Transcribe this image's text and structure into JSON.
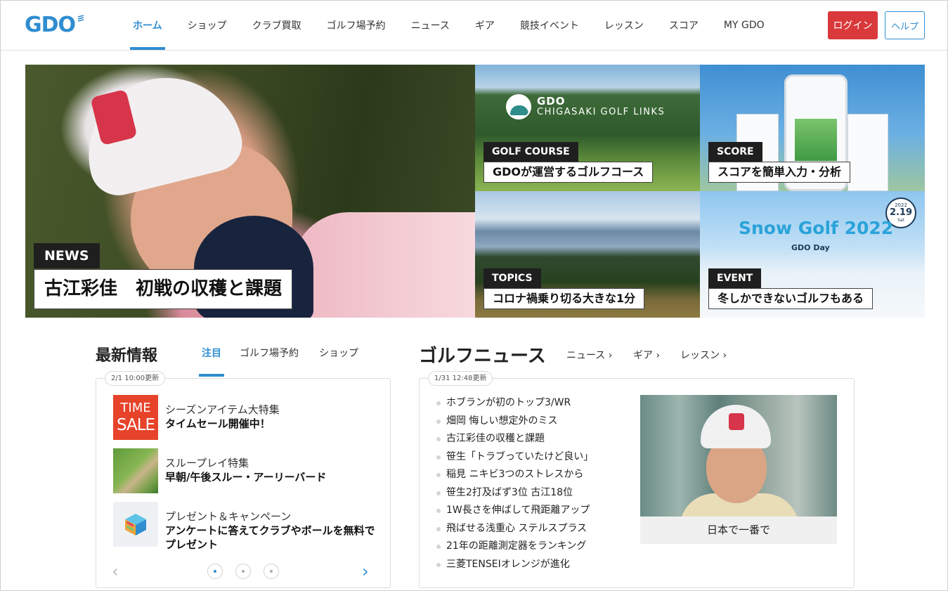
{
  "header": {
    "logo": "GDO",
    "nav": [
      "ホーム",
      "ショップ",
      "クラブ買取",
      "ゴルフ場予約",
      "ニュース",
      "ギア",
      "競技イベント",
      "レッスン",
      "スコア",
      "MY GDO"
    ],
    "login_label": "ログイン",
    "help_label": "ヘルプ"
  },
  "hero": {
    "main": {
      "tag": "NEWS",
      "caption": "古江彩佳　初戦の収穫と課題"
    },
    "course": {
      "logo_line1": "GDO",
      "logo_line2": "CHIGASAKI GOLF LINKS",
      "tag": "GOLF COURSE",
      "caption": "GDOが運営するゴルフコース"
    },
    "score": {
      "tag": "SCORE",
      "caption": "スコアを簡単入力・分析"
    },
    "topics": {
      "tag": "TOPICS",
      "caption": "コロナ禍乗り切る大きな1分"
    },
    "event": {
      "title": "Snow Golf 2022",
      "subtitle": "GDO Day",
      "badge_year": "2022",
      "badge_date": "2.19",
      "badge_day": "Sat",
      "tag": "EVENT",
      "caption": "冬しかできないゴルフもある"
    }
  },
  "latest": {
    "title": "最新情報",
    "tabs": [
      "注目",
      "ゴルフ場予約",
      "ショップ"
    ],
    "updated": "2/1 10:00更新",
    "items": [
      {
        "thumb_line1": "TIME",
        "thumb_line2": "SALE",
        "line1": "シーズンアイテム大特集",
        "line2": "タイムセール開催中！"
      },
      {
        "line1": "スループレイ特集",
        "line2": "早朝/午後スルー・アーリーバード"
      },
      {
        "line1": "プレゼント＆キャンペーン",
        "line2": "アンケートに答えてクラブやボールを無料でプレゼント"
      }
    ],
    "prev_arrow": "‹",
    "next_arrow": "›"
  },
  "golf_news": {
    "title": "ゴルフニュース",
    "links": [
      "ニュース ›",
      "ギア ›",
      "レッスン ›"
    ],
    "updated": "1/31 12:48更新",
    "items": [
      "ホブランが初のトップ3/WR",
      "畑岡 悔しい想定外のミス",
      "古江彩佳の収穫と課題",
      "笹生「トラブっていたけど良い」",
      "稲見 ニキビ3つのストレスから",
      "笹生2打及ばず3位 古江18位",
      "1W長さを伸ばして飛距離アップ",
      "飛ばせる浅重心 ステルスプラス",
      "21年の距離測定器をランキング",
      "三菱TENSEIオレンジが進化"
    ],
    "feature_caption": "日本で一番で"
  }
}
